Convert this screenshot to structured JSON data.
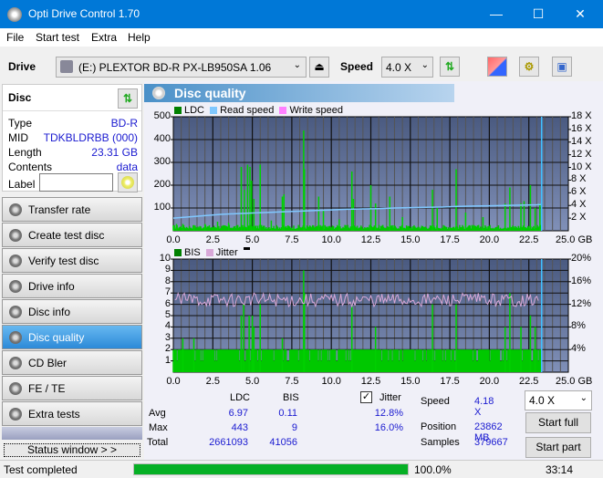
{
  "window": {
    "title": "Opti Drive Control 1.70",
    "minimize": "—",
    "maximize": "☐",
    "close": "✕"
  },
  "menu": [
    {
      "label": "File"
    },
    {
      "label": "Start test"
    },
    {
      "label": "Extra"
    },
    {
      "label": "Help"
    }
  ],
  "toolbar": {
    "drive_label": "Drive",
    "drive_value": "(E:)  PLEXTOR BD-R  PX-LB950SA 1.06",
    "speed_label": "Speed",
    "speed_value": "4.0 X"
  },
  "disc": {
    "title": "Disc",
    "type_label": "Type",
    "type_value": "BD-R",
    "mid_label": "MID",
    "mid_value": "TDKBLDRBB (000)",
    "length_label": "Length",
    "length_value": "23.31 GB",
    "contents_label": "Contents",
    "contents_value": "data",
    "label_label": "Label",
    "label_value": ""
  },
  "nav": [
    {
      "label": "Transfer rate"
    },
    {
      "label": "Create test disc"
    },
    {
      "label": "Verify test disc"
    },
    {
      "label": "Drive info"
    },
    {
      "label": "Disc info"
    },
    {
      "label": "Disc quality",
      "active": true
    },
    {
      "label": "CD Bler"
    },
    {
      "label": "FE / TE"
    },
    {
      "label": "Extra tests"
    }
  ],
  "status_window_label": "Status window > >",
  "panel_title": "Disc quality",
  "chart_data": [
    {
      "type": "bar",
      "title": "LDC / Read speed",
      "legend": [
        "LDC",
        "Read speed",
        "Write speed"
      ],
      "legend_colors": [
        "#008000",
        "#80c8ff",
        "#ff80ff"
      ],
      "xlabel": "GB",
      "xlim": [
        0,
        25
      ],
      "x_ticks": [
        "0.0",
        "2.5",
        "5.0",
        "7.5",
        "10.0",
        "12.5",
        "15.0",
        "17.5",
        "20.0",
        "22.5",
        "25.0 GB"
      ],
      "ylim": [
        0,
        500
      ],
      "y_ticks": [
        "500",
        "400",
        "300",
        "200",
        "100"
      ],
      "y2_ticks": [
        "18 X",
        "16 X",
        "14 X",
        "12 X",
        "10 X",
        "8 X",
        "6 X",
        "4 X",
        "2 X"
      ],
      "y2lim": [
        0,
        18
      ],
      "end_marker_x": 23.31,
      "series": [
        {
          "name": "LDC",
          "x": [
            0.2,
            0.6,
            1.3,
            2.0,
            2.8,
            3.5,
            4.3,
            4.5,
            4.7,
            4.85,
            4.95,
            5.1,
            5.5,
            6.2,
            6.9,
            7.0,
            8.25,
            8.3,
            9.2,
            9.5,
            10.5,
            11.3,
            11.4,
            12.5,
            12.8,
            13.7,
            14.5,
            16.4,
            16.7,
            17.9,
            18.5,
            19.6,
            21.0,
            21.3,
            22.0,
            22.2,
            22.6,
            22.9,
            23.2
          ],
          "values": [
            30,
            30,
            25,
            30,
            40,
            35,
            280,
            180,
            290,
            280,
            220,
            140,
            290,
            45,
            150,
            160,
            440,
            270,
            150,
            90,
            50,
            260,
            140,
            200,
            120,
            150,
            60,
            180,
            100,
            270,
            80,
            60,
            120,
            190,
            120,
            130,
            200,
            100,
            120
          ]
        },
        {
          "name": "Read speed",
          "x": [
            0,
            1,
            2,
            3,
            4,
            5,
            6,
            7,
            8,
            9,
            10,
            11,
            12,
            13,
            14,
            15,
            16,
            17,
            18,
            19,
            20,
            21,
            22,
            23,
            23.3
          ],
          "values": [
            2.0,
            2.2,
            2.4,
            2.6,
            2.7,
            2.8,
            2.9,
            3.0,
            3.1,
            3.2,
            3.3,
            3.4,
            3.45,
            3.5,
            3.6,
            3.65,
            3.7,
            3.75,
            3.85,
            3.9,
            3.95,
            4.0,
            4.05,
            4.1,
            4.18
          ]
        }
      ]
    },
    {
      "type": "bar",
      "title": "BIS / Jitter",
      "legend": [
        "BIS",
        "Jitter"
      ],
      "legend_colors": [
        "#008000",
        "#d8a8d8"
      ],
      "xlabel": "GB",
      "xlim": [
        0,
        25
      ],
      "x_ticks": [
        "0.0",
        "2.5",
        "5.0",
        "7.5",
        "10.0",
        "12.5",
        "15.0",
        "17.5",
        "20.0",
        "22.5",
        "25.0 GB"
      ],
      "ylim": [
        0,
        10
      ],
      "y_ticks": [
        "10",
        "9",
        "8",
        "7",
        "6",
        "5",
        "4",
        "3",
        "2",
        "1"
      ],
      "y2_ticks": [
        "20%",
        "16%",
        "12%",
        "8%",
        "4%"
      ],
      "y2lim": [
        0,
        20
      ],
      "end_marker_x": 23.31,
      "series": [
        {
          "name": "BIS",
          "baseline": 2,
          "x": [
            0.6,
            1.3,
            4.3,
            4.45,
            4.8,
            5.0,
            5.1,
            5.5,
            6.9,
            8.25,
            8.3,
            11.3,
            12.8,
            16.4,
            17.9,
            21.0,
            21.3,
            22.0,
            22.6,
            22.9
          ],
          "values": [
            3,
            3,
            5,
            6,
            5,
            5,
            4,
            6,
            3,
            9,
            7,
            6,
            4,
            6,
            6,
            4,
            7,
            4,
            5,
            4
          ]
        },
        {
          "name": "Jitter",
          "avg_percent": 12.8,
          "max_percent": 16.0
        }
      ]
    }
  ],
  "stats": {
    "col_ldc": "LDC",
    "col_bis": "BIS",
    "jitter_label": "Jitter",
    "jitter_checked": true,
    "rows": [
      {
        "label": "Avg",
        "ldc": "6.97",
        "bis": "0.11",
        "jitter": "12.8%"
      },
      {
        "label": "Max",
        "ldc": "443",
        "bis": "9",
        "jitter": "16.0%"
      },
      {
        "label": "Total",
        "ldc": "2661093",
        "bis": "41056"
      }
    ],
    "speed_label": "Speed",
    "speed_value": "4.18 X",
    "position_label": "Position",
    "position_value": "23862 MB",
    "samples_label": "Samples",
    "samples_value": "379667",
    "speed_select": "4.0 X",
    "start_full": "Start full",
    "start_part": "Start part"
  },
  "statusbar": {
    "text": "Test completed",
    "progress_percent": 100,
    "progress_label": "100.0%",
    "time": "33:14"
  }
}
